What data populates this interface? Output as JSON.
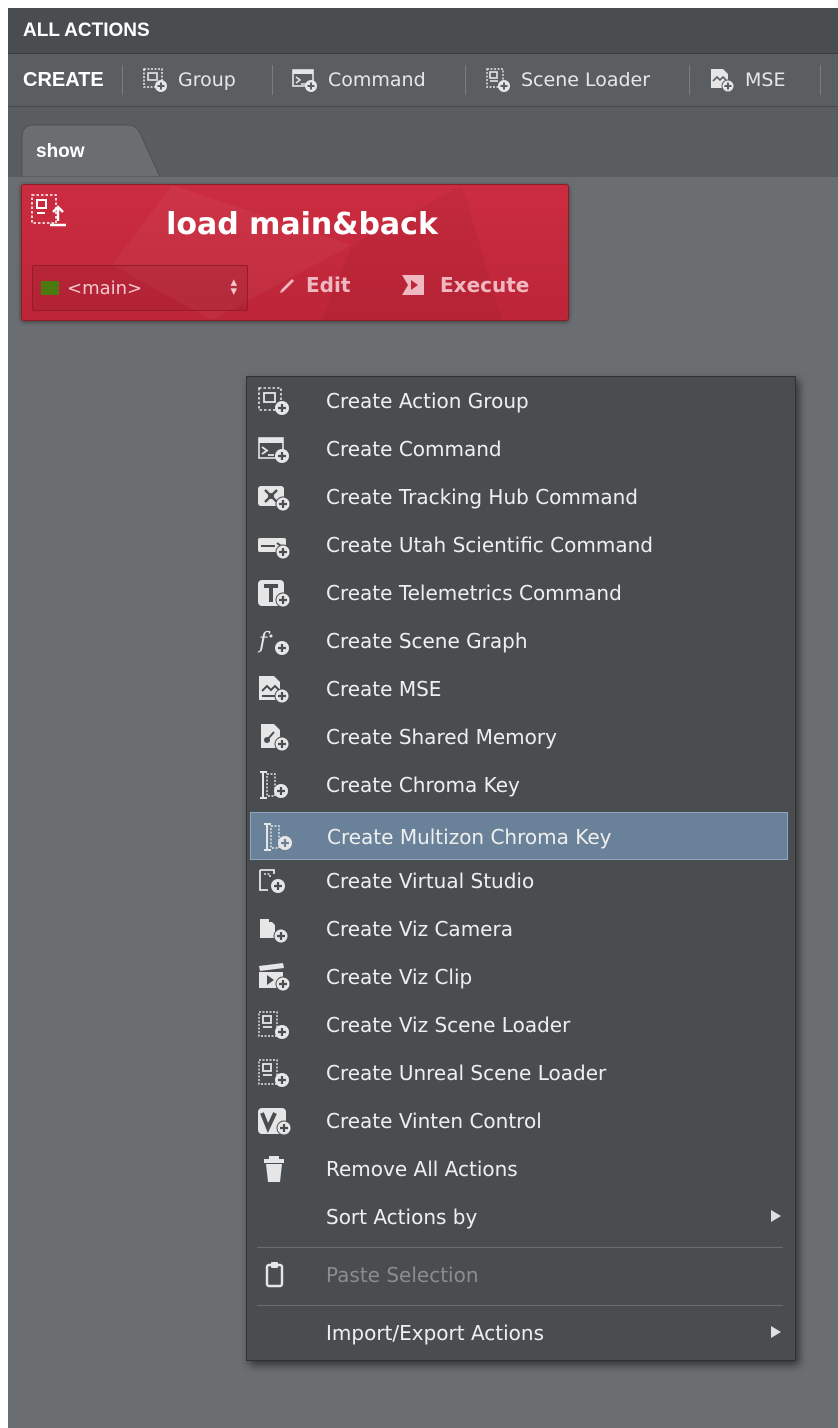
{
  "window": {
    "title": "ALL ACTIONS"
  },
  "toolbar": {
    "create_label": "CREATE",
    "buttons": [
      {
        "label": "Group",
        "icon": "group-add-icon"
      },
      {
        "label": "Command",
        "icon": "command-add-icon"
      },
      {
        "label": "Scene Loader",
        "icon": "scene-loader-add-icon"
      },
      {
        "label": "MSE",
        "icon": "mse-add-icon"
      }
    ]
  },
  "tabs": [
    {
      "label": "show",
      "active": true
    }
  ],
  "action_card": {
    "title": "load main&back",
    "icon": "scene-load-icon",
    "target": "<main>",
    "edit_label": "Edit",
    "execute_label": "Execute",
    "color": "#c8283c"
  },
  "context_menu": {
    "highlight_color": "#6a8299",
    "items": [
      {
        "label": "Create Action Group",
        "icon": "group-add-icon"
      },
      {
        "label": "Create Command",
        "icon": "command-add-icon"
      },
      {
        "label": "Create Tracking Hub Command",
        "icon": "tracking-hub-add-icon"
      },
      {
        "label": "Create Utah Scientific Command",
        "icon": "utah-scientific-add-icon"
      },
      {
        "label": "Create Telemetrics Command",
        "icon": "telemetrics-add-icon"
      },
      {
        "label": "Create Scene Graph",
        "icon": "scene-graph-add-icon"
      },
      {
        "label": "Create MSE",
        "icon": "mse-add-icon"
      },
      {
        "label": "Create Shared Memory",
        "icon": "shared-memory-add-icon"
      },
      {
        "label": "Create Chroma Key",
        "icon": "chroma-key-add-icon"
      },
      {
        "label": "Create Multizon Chroma Key",
        "icon": "multizone-chroma-key-add-icon",
        "highlighted": true
      },
      {
        "label": "Create Virtual Studio",
        "icon": "virtual-studio-add-icon"
      },
      {
        "label": "Create Viz Camera",
        "icon": "viz-camera-add-icon"
      },
      {
        "label": "Create Viz Clip",
        "icon": "viz-clip-add-icon"
      },
      {
        "label": "Create Viz Scene Loader",
        "icon": "viz-scene-loader-add-icon"
      },
      {
        "label": "Create Unreal Scene Loader",
        "icon": "unreal-scene-loader-add-icon"
      },
      {
        "label": "Create Vinten Control",
        "icon": "vinten-control-add-icon"
      },
      {
        "label": "Remove All Actions",
        "icon": "trash-icon"
      },
      {
        "label": "Sort Actions by",
        "submenu": true
      },
      {
        "label": "Paste Selection",
        "icon": "clipboard-icon",
        "disabled": true
      },
      {
        "label": "Import/Export Actions",
        "submenu": true
      }
    ]
  }
}
